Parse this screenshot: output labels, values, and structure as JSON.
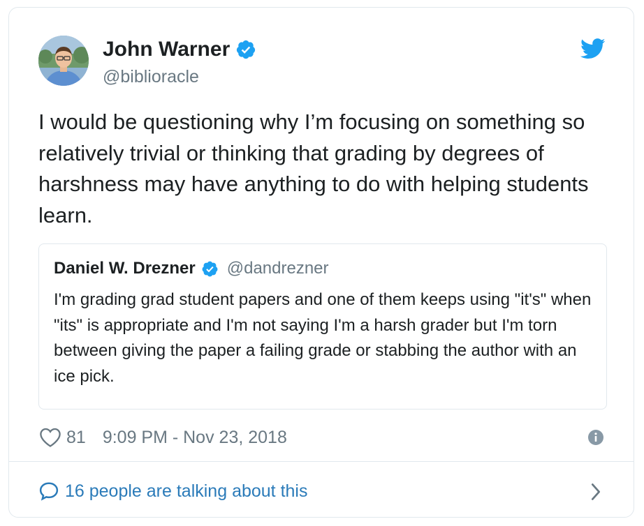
{
  "author": {
    "name": "John Warner",
    "handle": "@biblioracle",
    "verified": true
  },
  "tweet": {
    "text": "I would be questioning why I’m focusing on something so relatively trivial or thinking that grading by degrees of harshness may have anything to do with helping students learn."
  },
  "quoted_tweet": {
    "name": "Daniel W. Drezner",
    "handle": "@dandrezner",
    "verified": true,
    "text": "I'm grading grad student papers and one of them keeps using \"it's\" when \"its\" is appropriate and I'm not saying I'm a harsh grader but I'm torn between giving the paper a failing grade or stabbing the author with an ice pick."
  },
  "meta": {
    "likes": "81",
    "timestamp": "9:09 PM - Nov 23, 2018"
  },
  "footer": {
    "talking_label": "16 people are talking about this"
  },
  "icons": {
    "heart": "heart-icon",
    "info": "info-icon",
    "bubble": "speech-bubble-icon",
    "chevron": "chevron-right-icon",
    "twitter": "twitter-bird-icon",
    "verified": "verified-badge-icon"
  },
  "colors": {
    "verified_blue": "#1da1f2",
    "twitter_blue": "#1da1f2",
    "link_blue": "#2b7bb9",
    "secondary_text": "#697882",
    "border": "#e1e8ed"
  }
}
